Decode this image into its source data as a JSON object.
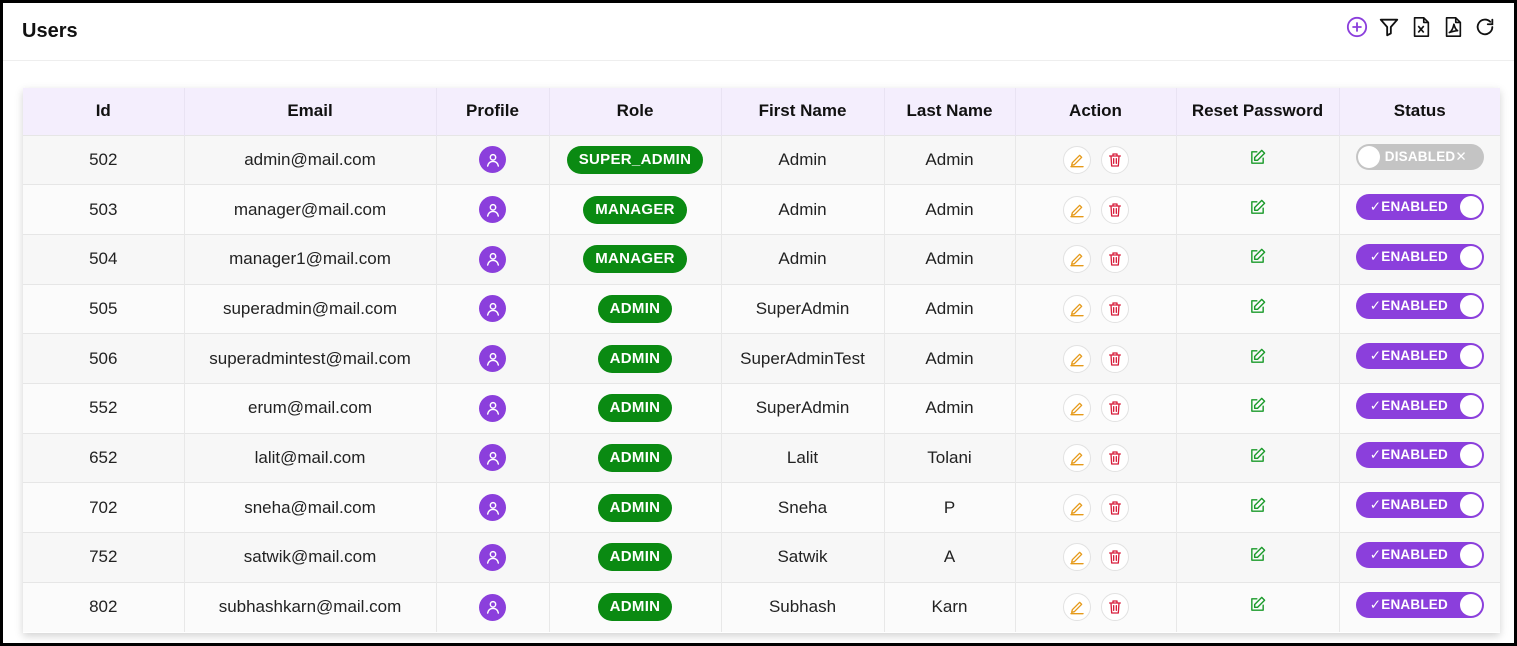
{
  "page": {
    "title": "Users"
  },
  "toolbar": [
    "add-icon",
    "filter-icon",
    "excel-export-icon",
    "pdf-export-icon",
    "refresh-icon"
  ],
  "colors": {
    "accent": "#8b3fdc",
    "role_badge": "#0a8a12",
    "edit": "#e69a1a",
    "delete": "#d81e3c",
    "reset": "#1a9a2a",
    "header_bg": "#f4eefd",
    "disabled": "#c4c4c4"
  },
  "table": {
    "columns": [
      "Id",
      "Email",
      "Profile",
      "Role",
      "First Name",
      "Last Name",
      "Action",
      "Reset Password",
      "Status"
    ],
    "rows": [
      {
        "id": "502",
        "email": "admin@mail.com",
        "role": "SUPER_ADMIN",
        "first_name": "Admin",
        "last_name": "Admin",
        "status": "DISABLED",
        "enabled": false
      },
      {
        "id": "503",
        "email": "manager@mail.com",
        "role": "MANAGER",
        "first_name": "Admin",
        "last_name": "Admin",
        "status": "ENABLED",
        "enabled": true
      },
      {
        "id": "504",
        "email": "manager1@mail.com",
        "role": "MANAGER",
        "first_name": "Admin",
        "last_name": "Admin",
        "status": "ENABLED",
        "enabled": true
      },
      {
        "id": "505",
        "email": "superadmin@mail.com",
        "role": "ADMIN",
        "first_name": "SuperAdmin",
        "last_name": "Admin",
        "status": "ENABLED",
        "enabled": true
      },
      {
        "id": "506",
        "email": "superadmintest@mail.com",
        "role": "ADMIN",
        "first_name": "SuperAdminTest",
        "last_name": "Admin",
        "status": "ENABLED",
        "enabled": true
      },
      {
        "id": "552",
        "email": "erum@mail.com",
        "role": "ADMIN",
        "first_name": "SuperAdmin",
        "last_name": "Admin",
        "status": "ENABLED",
        "enabled": true
      },
      {
        "id": "652",
        "email": "lalit@mail.com",
        "role": "ADMIN",
        "first_name": "Lalit",
        "last_name": "Tolani",
        "status": "ENABLED",
        "enabled": true
      },
      {
        "id": "702",
        "email": "sneha@mail.com",
        "role": "ADMIN",
        "first_name": "Sneha",
        "last_name": "P",
        "status": "ENABLED",
        "enabled": true
      },
      {
        "id": "752",
        "email": "satwik@mail.com",
        "role": "ADMIN",
        "first_name": "Satwik",
        "last_name": "A",
        "status": "ENABLED",
        "enabled": true
      },
      {
        "id": "802",
        "email": "subhashkarn@mail.com",
        "role": "ADMIN",
        "first_name": "Subhash",
        "last_name": "Karn",
        "status": "ENABLED",
        "enabled": true
      }
    ]
  }
}
